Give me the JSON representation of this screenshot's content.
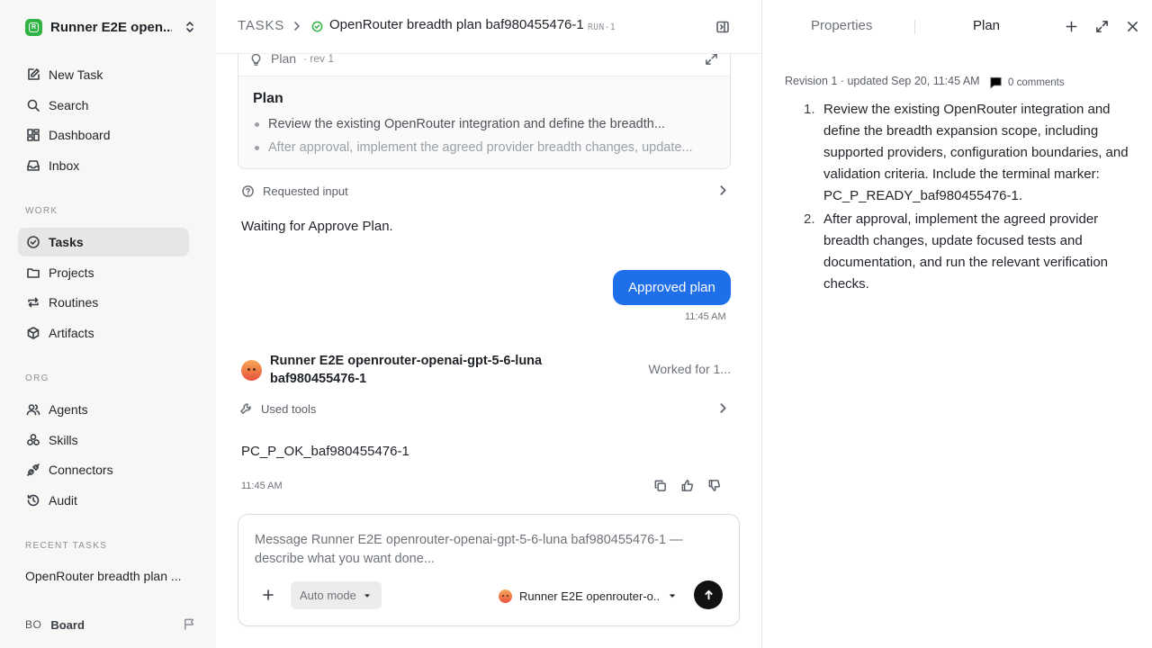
{
  "workspace": {
    "name": "Runner E2E open...",
    "logo_letter": "R"
  },
  "nav": {
    "top": [
      {
        "label": "New Task",
        "icon": "edit-icon"
      },
      {
        "label": "Search",
        "icon": "search-icon"
      },
      {
        "label": "Dashboard",
        "icon": "dashboard-icon"
      },
      {
        "label": "Inbox",
        "icon": "inbox-icon"
      }
    ],
    "work_label": "WORK",
    "work": [
      {
        "label": "Tasks",
        "icon": "check-circle-icon",
        "active": true
      },
      {
        "label": "Projects",
        "icon": "folder-icon"
      },
      {
        "label": "Routines",
        "icon": "repeat-icon"
      },
      {
        "label": "Artifacts",
        "icon": "package-icon"
      }
    ],
    "org_label": "ORG",
    "org": [
      {
        "label": "Agents",
        "icon": "users-icon"
      },
      {
        "label": "Skills",
        "icon": "skills-icon"
      },
      {
        "label": "Connectors",
        "icon": "plug-icon"
      },
      {
        "label": "Audit",
        "icon": "history-icon"
      }
    ],
    "recent_label": "RECENT TASKS",
    "recent": [
      {
        "label": "OpenRouter breadth plan ..."
      }
    ],
    "board": {
      "initials": "BO",
      "label": "Board"
    }
  },
  "header": {
    "root": "TASKS",
    "title": "OpenRouter breadth plan baf980455476-1",
    "run_id": "RUN-1"
  },
  "plan_card": {
    "tag": "Plan",
    "rev": "· rev 1",
    "title": "Plan",
    "bullets": [
      "Review the existing OpenRouter integration and define the breadth...",
      "After approval, implement the agreed provider breadth changes, update..."
    ]
  },
  "requested_input": {
    "label": "Requested input"
  },
  "waiting_text": "Waiting for Approve Plan.",
  "user_message": {
    "text": "Approved plan",
    "time": "11:45 AM"
  },
  "agent": {
    "name": "Runner E2E openrouter-openai-gpt-5-6-luna baf980455476-1",
    "worked": "Worked for 1...",
    "tools_label": "Used tools",
    "output": "PC_P_OK_baf980455476-1",
    "time": "11:45 AM"
  },
  "composer": {
    "placeholder": "Message Runner E2E openrouter-openai-gpt-5-6-luna baf980455476-1 — describe what you want done...",
    "mode": "Auto mode",
    "agent_label": "Runner E2E openrouter-o..."
  },
  "right_panel": {
    "tabs": [
      "Properties",
      "Plan"
    ],
    "active_tab": "Plan",
    "meta": "Revision 1 · updated Sep 20, 11:45 AM",
    "comments": "0 comments",
    "items": [
      "Review the existing OpenRouter integration and define the breadth expansion scope, including supported providers, configuration boundaries, and validation criteria. Include the terminal marker: PC_P_READY_baf980455476-1.",
      "After approval, implement the agreed provider breadth changes, update focused tests and documentation, and run the relevant verification checks."
    ]
  },
  "colors": {
    "accent": "#1f6feb",
    "brand": "#2fb344",
    "sidebar_bg": "#f7f7f6"
  }
}
